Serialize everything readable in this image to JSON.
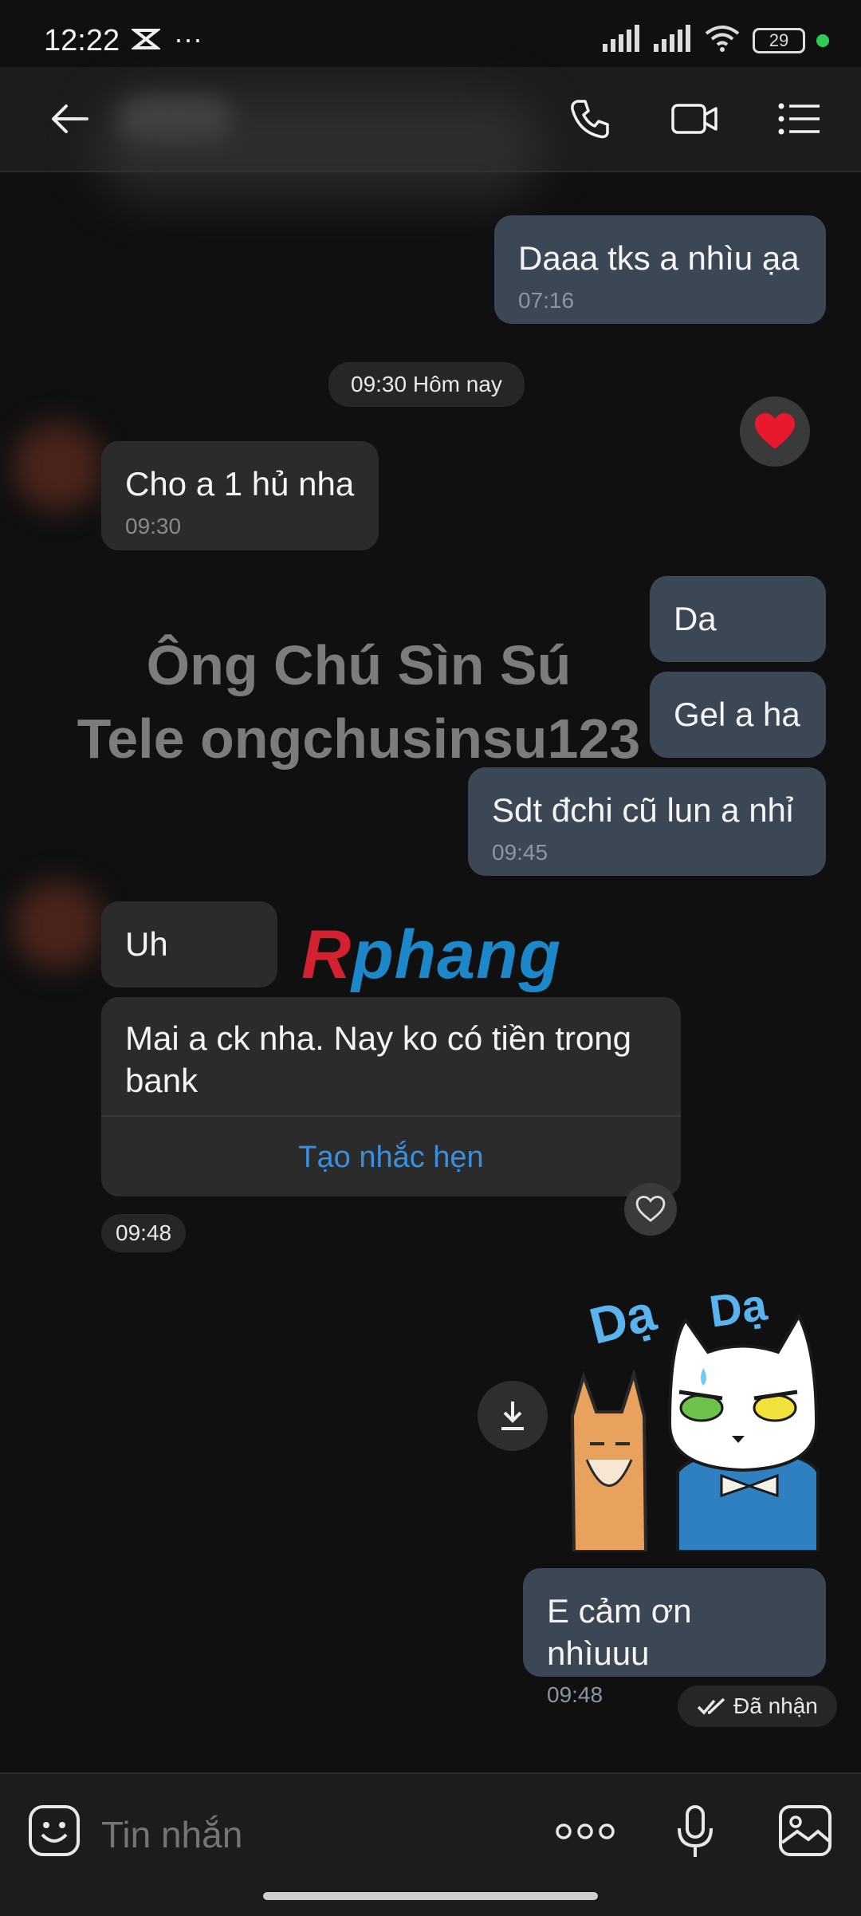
{
  "status_bar": {
    "time": "12:22",
    "battery": "29"
  },
  "watermark": {
    "line1": "Ông Chú Sìn Sú",
    "line2": "Tele ongchusinsu123"
  },
  "brand": {
    "left": "R",
    "right": "phang"
  },
  "messages": [
    {
      "text": "Daaa tks a nhìu ạa",
      "time": "07:16"
    },
    {
      "text": "Cho a 1 hủ nha",
      "time": "09:30"
    },
    {
      "text": "Da"
    },
    {
      "text": "Gel a ha"
    },
    {
      "text": "Sdt đchi cũ lun a nhỉ",
      "time": "09:45"
    },
    {
      "text": "Uh"
    },
    {
      "text": "Mai a ck nha. Nay ko có tiền trong bank",
      "action": "Tạo nhắc hẹn"
    },
    {
      "text": "E cảm ơn nhìuuu",
      "time": "09:48"
    }
  ],
  "date_chip": "09:30 Hôm nay",
  "time_chip": "09:48",
  "sticker": {
    "left_text": "Dạ",
    "right_text": "Dạ"
  },
  "receipt": "Đã nhận",
  "input": {
    "placeholder": "Tin nhắn"
  },
  "colors": {
    "accent": "#3a8fe0",
    "out_bubble": "#3c4755",
    "in_bubble": "#2b2b2b",
    "online": "#2ecc55"
  }
}
